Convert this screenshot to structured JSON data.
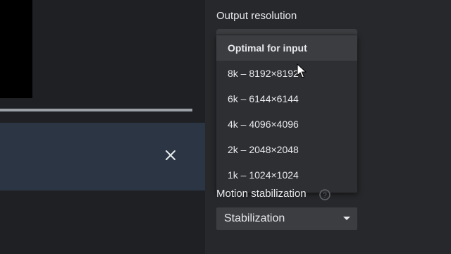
{
  "colors": {
    "background": "#202124",
    "panel": "#27282b",
    "dropdown": "#2e2f32",
    "selected_option": "#3c3d40",
    "blue_panel": "#2b3544",
    "text": "#e8eaed"
  },
  "player": {
    "progress_fraction": 1.0,
    "close_icon": "close-icon"
  },
  "settings": {
    "output_resolution": {
      "title": "Output resolution",
      "options": [
        "Optimal for input",
        "8k – 8192×8192",
        "6k – 6144×6144",
        "4k – 4096×4096",
        "2k – 2048×2048",
        "1k – 1024×1024"
      ],
      "selected_index": 0
    },
    "motion_stabilization": {
      "title": "Motion stabilization",
      "help_icon": "help-circle-icon",
      "value": "Stabilization"
    }
  }
}
